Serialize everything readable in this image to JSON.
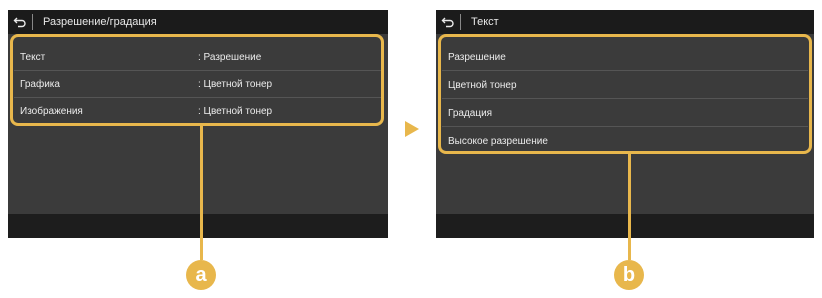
{
  "left_screen": {
    "title": "Разрешение/градация",
    "rows": [
      {
        "label": "Текст",
        "value": ": Разрешение"
      },
      {
        "label": "Графика",
        "value": ": Цветной тонер"
      },
      {
        "label": "Изображения",
        "value": ": Цветной тонер"
      }
    ]
  },
  "right_screen": {
    "title": "Текст",
    "options": [
      "Разрешение",
      "Цветной тонер",
      "Градация",
      "Высокое разрешение"
    ]
  },
  "callouts": {
    "a": "a",
    "b": "b"
  },
  "colors": {
    "accent": "#e8b74c",
    "screen_bg": "#3b3b3b",
    "titlebar_bg": "#1b1b1b"
  },
  "icons": {
    "back": "back-arrow-icon",
    "next": "play-triangle-icon"
  }
}
